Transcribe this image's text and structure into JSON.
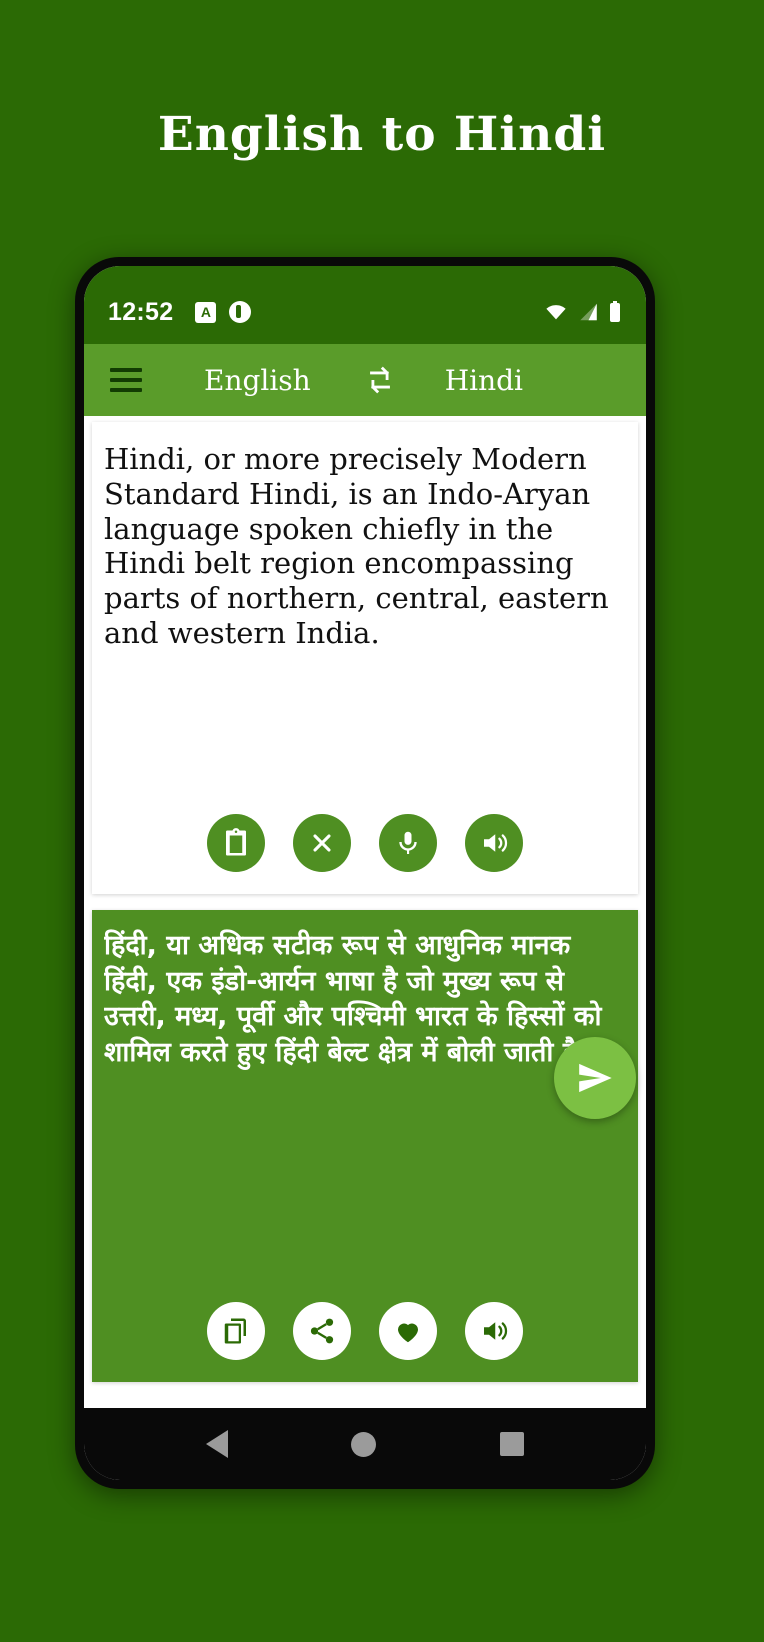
{
  "page": {
    "title": "English to Hindi",
    "background_color": "#2b6a05"
  },
  "status_bar": {
    "time": "12:52",
    "left_icons": [
      "app-notification-badge-icon",
      "app-notification-circle-icon"
    ],
    "right_icons": [
      "wifi-icon",
      "cellular-signal-icon",
      "battery-icon"
    ],
    "background_color": "#2b6a05"
  },
  "app_bar": {
    "menu_icon": "hamburger-menu-icon",
    "source_language": "English",
    "swap_icon": "swap-languages-icon",
    "target_language": "Hindi",
    "background_color": "#5a9c2a"
  },
  "source_card": {
    "text": "Hindi, or more precisely Modern Standard Hindi, is an Indo-Aryan language spoken chiefly in the Hindi belt region encompassing parts of northern, central, eastern and western India.",
    "actions": [
      {
        "name": "paste-button",
        "icon": "clipboard-icon",
        "label": "Paste"
      },
      {
        "name": "clear-button",
        "icon": "close-x-icon",
        "label": "Clear"
      },
      {
        "name": "voice-input-button",
        "icon": "microphone-icon",
        "label": "Voice input"
      },
      {
        "name": "speak-source-button",
        "icon": "speaker-icon",
        "label": "Speak"
      }
    ],
    "button_color": "#4f8f22"
  },
  "translate_fab": {
    "icon": "send-icon",
    "label": "Translate",
    "color": "#7cc043"
  },
  "result_card": {
    "text": "हिंदी, या अधिक सटीक रूप से आधुनिक मानक हिंदी, एक इंडो-आर्यन भाषा है जो मुख्य रूप से उत्तरी, मध्य, पूर्वी और पश्चिमी भारत के हिस्सों को शामिल करते हुए हिंदी बेल्ट क्षेत्र में बोली जाती है।",
    "background_color": "#4f8f22",
    "actions": [
      {
        "name": "copy-button",
        "icon": "copy-icon",
        "label": "Copy"
      },
      {
        "name": "share-button",
        "icon": "share-icon",
        "label": "Share"
      },
      {
        "name": "favorite-button",
        "icon": "heart-icon",
        "label": "Favorite"
      },
      {
        "name": "speak-result-button",
        "icon": "speaker-icon",
        "label": "Speak"
      }
    ]
  },
  "nav_bar": {
    "back": "back-triangle-icon",
    "home": "home-circle-icon",
    "recents": "recents-square-icon"
  }
}
